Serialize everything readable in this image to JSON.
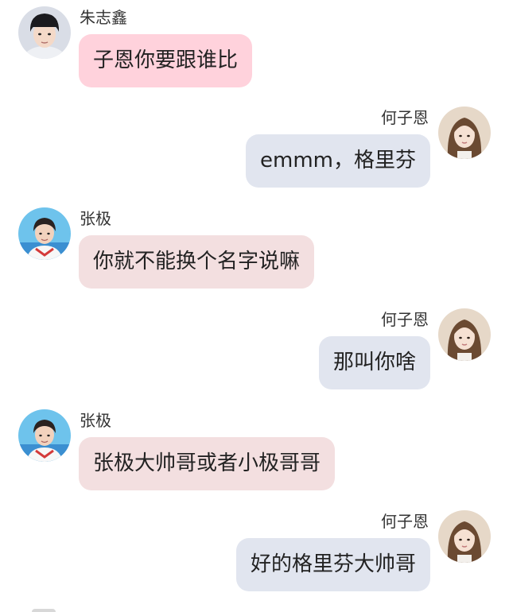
{
  "messages": [
    {
      "side": "left",
      "name": "朱志鑫",
      "text": "子恩你要跟谁比",
      "avatar": "avatar-zhu-zhixin",
      "bubble_color": "#ffd2dc"
    },
    {
      "side": "right",
      "name": "何子恩",
      "text": "emmm，格里芬",
      "avatar": "avatar-he-zien",
      "bubble_color": "#e1e5ef"
    },
    {
      "side": "left",
      "name": "张极",
      "text": "你就不能换个名字说嘛",
      "avatar": "avatar-zhang-ji",
      "bubble_color": "#f3dfe0"
    },
    {
      "side": "right",
      "name": "何子恩",
      "text": "那叫你啥",
      "avatar": "avatar-he-zien",
      "bubble_color": "#e1e5ef"
    },
    {
      "side": "left",
      "name": "张极",
      "text": "张极大帅哥或者小极哥哥",
      "avatar": "avatar-zhang-ji",
      "bubble_color": "#f3dfe0"
    },
    {
      "side": "right",
      "name": "何子恩",
      "text": "好的格里芬大帅哥",
      "avatar": "avatar-he-zien",
      "bubble_color": "#e1e5ef"
    }
  ]
}
